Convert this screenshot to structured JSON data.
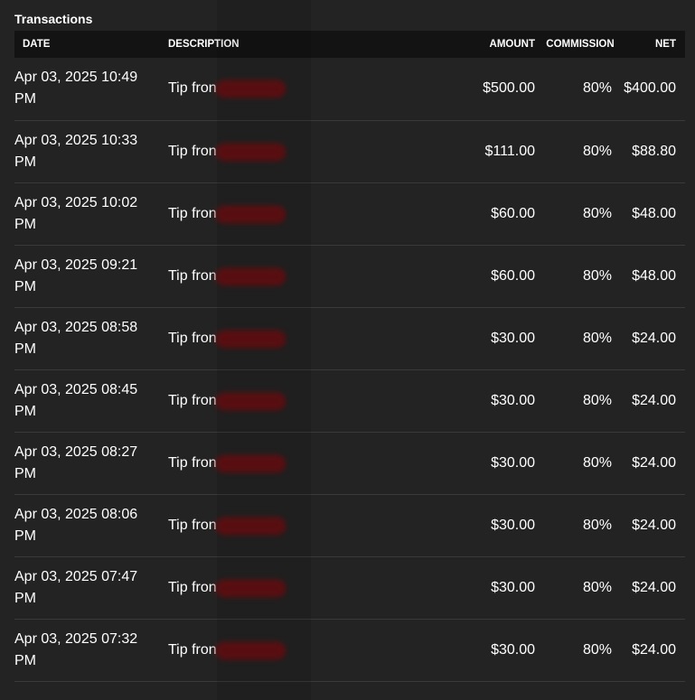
{
  "panel": {
    "title": "Transactions"
  },
  "table": {
    "headers": {
      "date": "DATE",
      "description": "DESCRIPTION",
      "amount": "AMOUNT",
      "commission": "COMMISSION",
      "net": "NET"
    },
    "rows": [
      {
        "date": "Apr 03, 2025 10:49 PM",
        "description": "Tip fron",
        "amount": "$500.00",
        "commission": "80%",
        "net": "$400.00"
      },
      {
        "date": "Apr 03, 2025 10:33 PM",
        "description": "Tip fron",
        "amount": "$111.00",
        "commission": "80%",
        "net": "$88.80"
      },
      {
        "date": "Apr 03, 2025 10:02 PM",
        "description": "Tip fron",
        "amount": "$60.00",
        "commission": "80%",
        "net": "$48.00"
      },
      {
        "date": "Apr 03, 2025 09:21 PM",
        "description": "Tip fron",
        "amount": "$60.00",
        "commission": "80%",
        "net": "$48.00"
      },
      {
        "date": "Apr 03, 2025 08:58 PM",
        "description": "Tip fron",
        "amount": "$30.00",
        "commission": "80%",
        "net": "$24.00"
      },
      {
        "date": "Apr 03, 2025 08:45 PM",
        "description": "Tip fron",
        "amount": "$30.00",
        "commission": "80%",
        "net": "$24.00"
      },
      {
        "date": "Apr 03, 2025 08:27 PM",
        "description": "Tip fron",
        "amount": "$30.00",
        "commission": "80%",
        "net": "$24.00"
      },
      {
        "date": "Apr 03, 2025 08:06 PM",
        "description": "Tip fron",
        "amount": "$30.00",
        "commission": "80%",
        "net": "$24.00"
      },
      {
        "date": "Apr 03, 2025 07:47 PM",
        "description": "Tip fron",
        "amount": "$30.00",
        "commission": "80%",
        "net": "$24.00"
      },
      {
        "date": "Apr 03, 2025 07:32 PM",
        "description": "Tip fron",
        "amount": "$30.00",
        "commission": "80%",
        "net": "$24.00"
      }
    ]
  },
  "colors": {
    "background": "#232323",
    "header_background": "#131313",
    "row_divider": "#3a3a3a",
    "redaction": "#6a0f12",
    "text": "#ffffff"
  }
}
